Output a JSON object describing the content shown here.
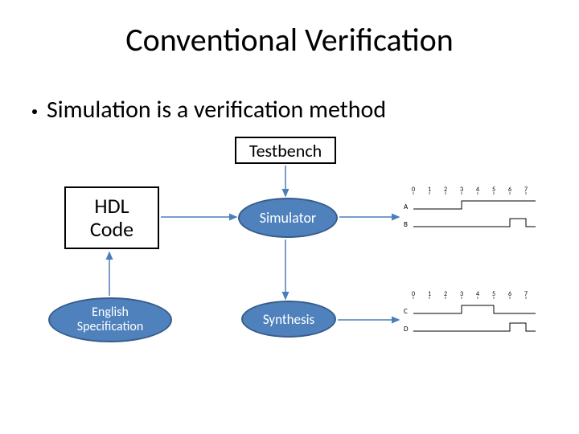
{
  "title": "Conventional Verification",
  "bullet": "Simulation is a verification method",
  "nodes": {
    "testbench": "Testbench",
    "hdl_line1": "HDL",
    "hdl_line2": "Code",
    "simulator": "Simulator",
    "english_line1": "English",
    "english_line2": "Specification",
    "synthesis": "Synthesis"
  },
  "waveforms": {
    "top": {
      "ticks": [
        "0",
        "1",
        "2",
        "3",
        "4",
        "5",
        "6",
        "7"
      ],
      "rows": [
        {
          "label": "A",
          "transitions": [
            0,
            0,
            0,
            1,
            1,
            1,
            1,
            1
          ]
        },
        {
          "label": "B",
          "transitions": [
            0,
            0,
            0,
            0,
            0,
            0,
            1,
            0
          ]
        }
      ]
    },
    "bottom": {
      "ticks": [
        "0",
        "1",
        "2",
        "3",
        "4",
        "5",
        "6",
        "7"
      ],
      "rows": [
        {
          "label": "C",
          "transitions": [
            0,
            0,
            0,
            1,
            1,
            0,
            0,
            0
          ]
        },
        {
          "label": "D",
          "transitions": [
            0,
            0,
            0,
            0,
            0,
            0,
            1,
            0
          ]
        }
      ]
    }
  }
}
